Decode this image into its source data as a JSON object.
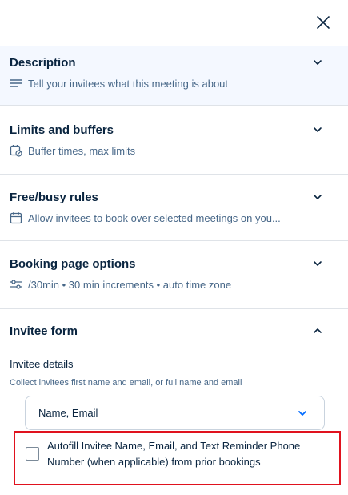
{
  "panel": {
    "close_icon": "close-icon"
  },
  "sections": {
    "description": {
      "title": "Description",
      "subtitle": "Tell your invitees what this meeting is about",
      "icon": "text-lines-icon"
    },
    "limits": {
      "title": "Limits and buffers",
      "subtitle": "Buffer times, max limits",
      "icon": "calendar-clock-icon"
    },
    "busy": {
      "title": "Free/busy rules",
      "subtitle": "Allow invitees to book over selected meetings on you...",
      "icon": "calendar-icon"
    },
    "booking": {
      "title": "Booking page options",
      "subtitle": "/30min • 30 min increments • auto time zone",
      "icon": "sliders-icon"
    }
  },
  "invitee_form": {
    "title": "Invitee form",
    "details_label": "Invitee details",
    "details_help": "Collect invitees first name and email, or full name and email",
    "name_select_value": "Name, Email",
    "autofill_label": "Autofill Invitee Name, Email, and Text Reminder Phone Number (when applicable) from prior bookings",
    "autofill_checked": false
  },
  "colors": {
    "accent": "#006bff",
    "highlight_border": "#e0121e",
    "active_section_bg": "#f4f8ff"
  }
}
